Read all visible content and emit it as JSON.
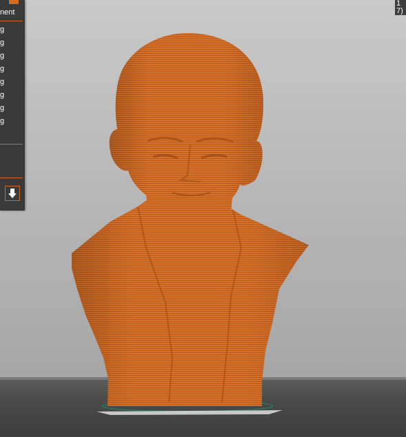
{
  "side_panel": {
    "title": "nent",
    "layer_rows": [
      "g",
      "g",
      "g",
      "g",
      "g",
      "g",
      "g",
      "g"
    ],
    "download_icon": "arrow-down-icon"
  },
  "readout": {
    "line1": "1",
    "line2": "(7"
  },
  "viewport": {
    "model": "sliced-bust",
    "model_color": "#d46a1e",
    "layer_line_color": "#b9561a",
    "background_color": "#bdbdbd",
    "plate_color": "#4a4a4a",
    "accent_color": "#d46a1e"
  }
}
